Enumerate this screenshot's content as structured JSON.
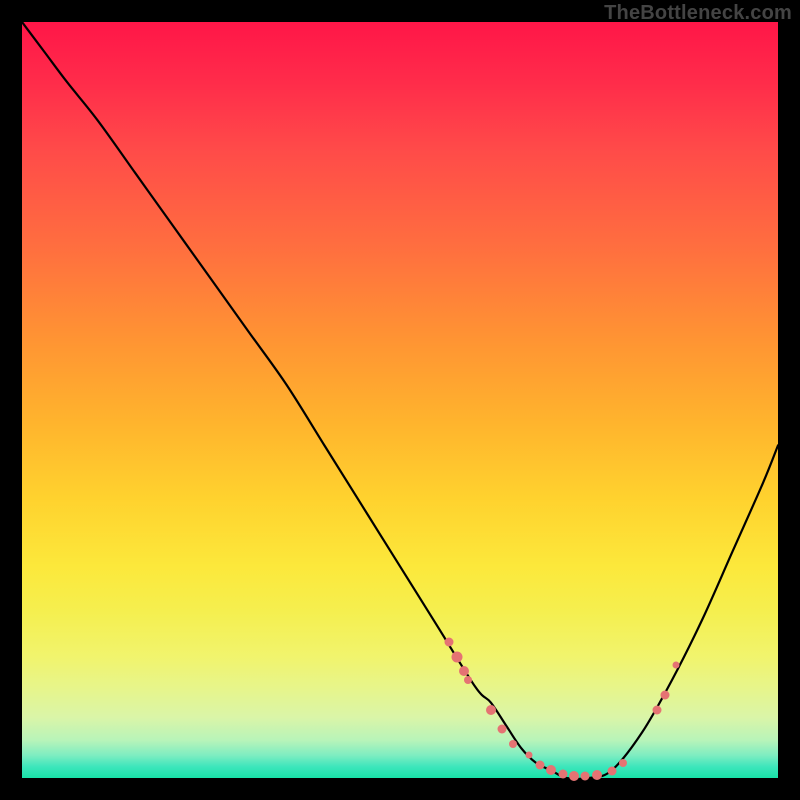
{
  "watermark": "TheBottleneck.com",
  "chart_data": {
    "type": "line",
    "title": "",
    "xlabel": "",
    "ylabel": "",
    "xlim": [
      0,
      100
    ],
    "ylim": [
      0,
      100
    ],
    "curve": {
      "name": "curve",
      "x": [
        0,
        3,
        6,
        10,
        15,
        20,
        25,
        30,
        35,
        40,
        45,
        50,
        55,
        60,
        62,
        64,
        66,
        68,
        70,
        72,
        75,
        78,
        82,
        86,
        90,
        94,
        98,
        100
      ],
      "y": [
        100,
        96,
        92,
        87,
        80,
        73,
        66,
        59,
        52,
        44,
        36,
        28,
        20,
        12,
        10,
        7,
        4,
        2,
        1,
        0,
        0,
        1,
        6,
        13,
        21,
        30,
        39,
        44
      ]
    },
    "markers": {
      "name": "markers",
      "color": "#e57373",
      "points": [
        {
          "x": 56.5,
          "y": 18,
          "size": 9
        },
        {
          "x": 57.5,
          "y": 16,
          "size": 11
        },
        {
          "x": 58.5,
          "y": 14.2,
          "size": 10
        },
        {
          "x": 59,
          "y": 13,
          "size": 8
        },
        {
          "x": 62,
          "y": 9,
          "size": 10
        },
        {
          "x": 63.5,
          "y": 6.5,
          "size": 9
        },
        {
          "x": 65,
          "y": 4.5,
          "size": 8
        },
        {
          "x": 67,
          "y": 3,
          "size": 7
        },
        {
          "x": 68.5,
          "y": 1.7,
          "size": 9
        },
        {
          "x": 70,
          "y": 1,
          "size": 10
        },
        {
          "x": 71.5,
          "y": 0.5,
          "size": 9
        },
        {
          "x": 73,
          "y": 0.3,
          "size": 10
        },
        {
          "x": 74.5,
          "y": 0.2,
          "size": 9
        },
        {
          "x": 76,
          "y": 0.4,
          "size": 10
        },
        {
          "x": 78,
          "y": 0.9,
          "size": 9
        },
        {
          "x": 79.5,
          "y": 2,
          "size": 8
        },
        {
          "x": 84,
          "y": 9,
          "size": 9
        },
        {
          "x": 85,
          "y": 11,
          "size": 9
        },
        {
          "x": 86.5,
          "y": 15,
          "size": 7
        }
      ]
    }
  }
}
